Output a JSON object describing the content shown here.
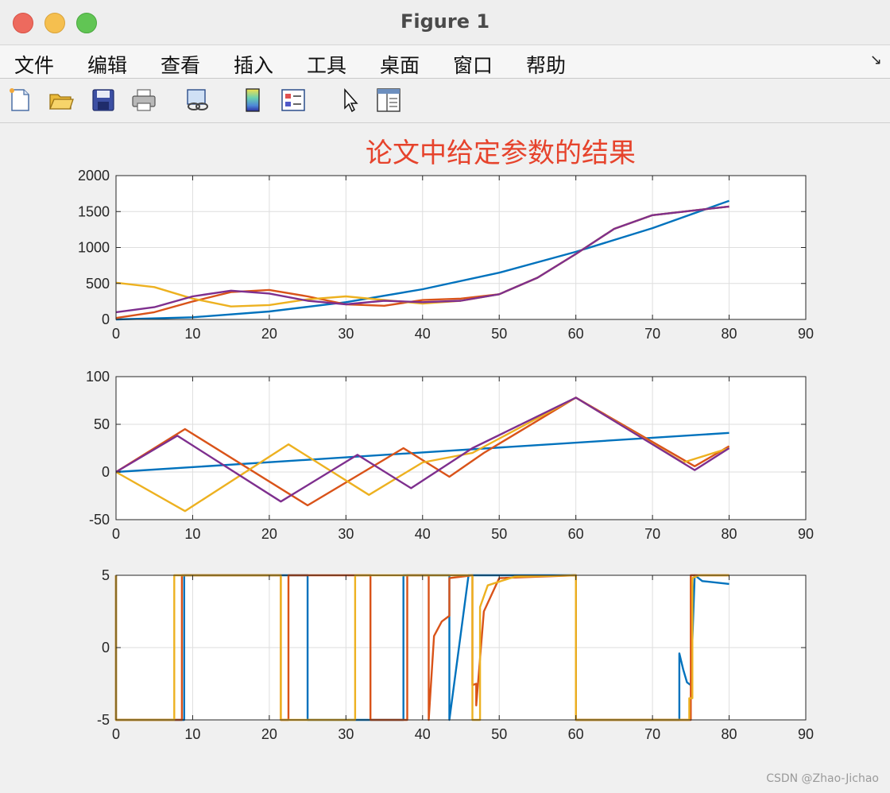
{
  "window": {
    "title": "Figure 1"
  },
  "menu": {
    "items": [
      "文件",
      "编辑",
      "查看",
      "插入",
      "工具",
      "桌面",
      "窗口",
      "帮助"
    ],
    "overflow_icon": "arrow-icon"
  },
  "toolbar": {
    "icons": [
      "new-figure-icon",
      "open-folder-icon",
      "save-icon",
      "print-icon",
      "link-icon",
      "colorbar-icon",
      "legend-icon",
      "pointer-icon",
      "property-inspector-icon"
    ]
  },
  "watermark": "CSDN @Zhao-Jichao",
  "colors": {
    "blue": "#0072bd",
    "orange": "#d95319",
    "yellow": "#edb120",
    "purple": "#7e2f8e",
    "title": "#e6432c"
  },
  "chart_data": [
    {
      "type": "line",
      "title": "论文中给定参数的结果",
      "xlim": [
        0,
        90
      ],
      "ylim": [
        0,
        2000
      ],
      "xticks": [
        0,
        10,
        20,
        30,
        40,
        50,
        60,
        70,
        80,
        90
      ],
      "yticks": [
        0,
        500,
        1000,
        1500,
        2000
      ],
      "grid": true,
      "series": [
        {
          "color": "#0072bd",
          "x": [
            0,
            10,
            20,
            30,
            40,
            50,
            60,
            70,
            80
          ],
          "y": [
            0,
            30,
            110,
            240,
            420,
            650,
            940,
            1270,
            1650
          ]
        },
        {
          "color": "#d95319",
          "x": [
            0,
            5,
            10,
            15,
            20,
            25,
            30,
            35,
            40,
            45,
            50,
            55,
            60,
            65,
            70,
            75,
            80
          ],
          "y": [
            20,
            100,
            250,
            380,
            410,
            320,
            210,
            190,
            270,
            290,
            350,
            580,
            910,
            1260,
            1450,
            1510,
            1570
          ]
        },
        {
          "color": "#edb120",
          "x": [
            0,
            5,
            10,
            15,
            20,
            25,
            30,
            35,
            40,
            45,
            50,
            55,
            60,
            65,
            70,
            75,
            80
          ],
          "y": [
            510,
            450,
            290,
            180,
            200,
            280,
            320,
            270,
            220,
            260,
            350,
            580,
            910,
            1260,
            1450,
            1510,
            1570
          ]
        },
        {
          "color": "#7e2f8e",
          "x": [
            0,
            5,
            10,
            15,
            20,
            25,
            30,
            35,
            40,
            45,
            50,
            55,
            60,
            65,
            70,
            75,
            80
          ],
          "y": [
            100,
            170,
            320,
            400,
            360,
            260,
            210,
            260,
            240,
            260,
            350,
            580,
            910,
            1260,
            1450,
            1510,
            1570
          ]
        }
      ]
    },
    {
      "type": "line",
      "xlim": [
        0,
        90
      ],
      "ylim": [
        -50,
        100
      ],
      "xticks": [
        0,
        10,
        20,
        30,
        40,
        50,
        60,
        70,
        80,
        90
      ],
      "yticks": [
        -50,
        0,
        50,
        100
      ],
      "grid": true,
      "series": [
        {
          "color": "#0072bd",
          "x": [
            0,
            80
          ],
          "y": [
            0,
            41
          ]
        },
        {
          "color": "#d95319",
          "x": [
            0,
            9,
            25,
            37.5,
            43.5,
            48,
            60,
            75.5,
            80
          ],
          "y": [
            0,
            45,
            -35,
            25,
            -5,
            20,
            78,
            6,
            27
          ]
        },
        {
          "color": "#edb120",
          "x": [
            0,
            9,
            22.5,
            33,
            40,
            46.5,
            60,
            74,
            80
          ],
          "y": [
            0,
            -41,
            29,
            -24,
            10,
            20,
            78,
            10,
            25
          ]
        },
        {
          "color": "#7e2f8e",
          "x": [
            0,
            8,
            21.5,
            31.5,
            38.5,
            46.5,
            60,
            75.5,
            80
          ],
          "y": [
            0,
            38,
            -31,
            18,
            -17,
            25,
            78,
            2,
            25
          ]
        }
      ]
    },
    {
      "type": "line",
      "xlim": [
        0,
        90
      ],
      "ylim": [
        -5,
        5
      ],
      "xticks": [
        0,
        10,
        20,
        30,
        40,
        50,
        60,
        70,
        80,
        90
      ],
      "yticks": [
        -5,
        0,
        5
      ],
      "grid": true,
      "series": [
        {
          "color": "#0072bd",
          "x": [
            0,
            0,
            8.9,
            8.9,
            25,
            25,
            37.5,
            37.5,
            43.5,
            43.5,
            46,
            49,
            52,
            56,
            60,
            60,
            73.5,
            73.5,
            74,
            74.5,
            75,
            75.5,
            76,
            76.5,
            80
          ],
          "y": [
            5,
            -5,
            -5,
            5,
            5,
            -5,
            -5,
            5,
            5,
            -5,
            5,
            5,
            5,
            5,
            5,
            -5,
            -5,
            -0.4,
            -1.5,
            -2.4,
            -2.6,
            5,
            4.8,
            4.6,
            4.4
          ]
        },
        {
          "color": "#d95319",
          "x": [
            0,
            0,
            8.6,
            8.6,
            21.5,
            21.5,
            22.5,
            22.5,
            33.2,
            33.2,
            38,
            38,
            40.8,
            40.8,
            41.5,
            42.5,
            43.5,
            43.5,
            46.5,
            46.5,
            47,
            47,
            48,
            50,
            60,
            60,
            75,
            75,
            80
          ],
          "y": [
            5,
            -5,
            -5,
            5,
            5,
            -5,
            -5,
            5,
            5,
            -5,
            -5,
            5,
            5,
            -5,
            0.8,
            1.8,
            2.2,
            4.8,
            5,
            -2.6,
            -2.5,
            -4,
            2.5,
            4.8,
            5,
            -5,
            -5,
            5,
            5
          ]
        },
        {
          "color": "#edb120",
          "x": [
            0,
            0,
            7.6,
            7.6,
            21.5,
            21.5,
            31.2,
            31.2,
            46.5,
            46.5,
            47.5,
            47.5,
            48.5,
            52,
            60,
            60,
            74.8,
            74.8,
            75.2,
            75.2,
            76,
            80
          ],
          "y": [
            5,
            -5,
            -5,
            5,
            5,
            -5,
            -5,
            5,
            5,
            -5,
            -5,
            2.8,
            4.3,
            4.9,
            5,
            -5,
            -5,
            -3.5,
            -3.5,
            4.8,
            5,
            5
          ]
        }
      ]
    }
  ]
}
